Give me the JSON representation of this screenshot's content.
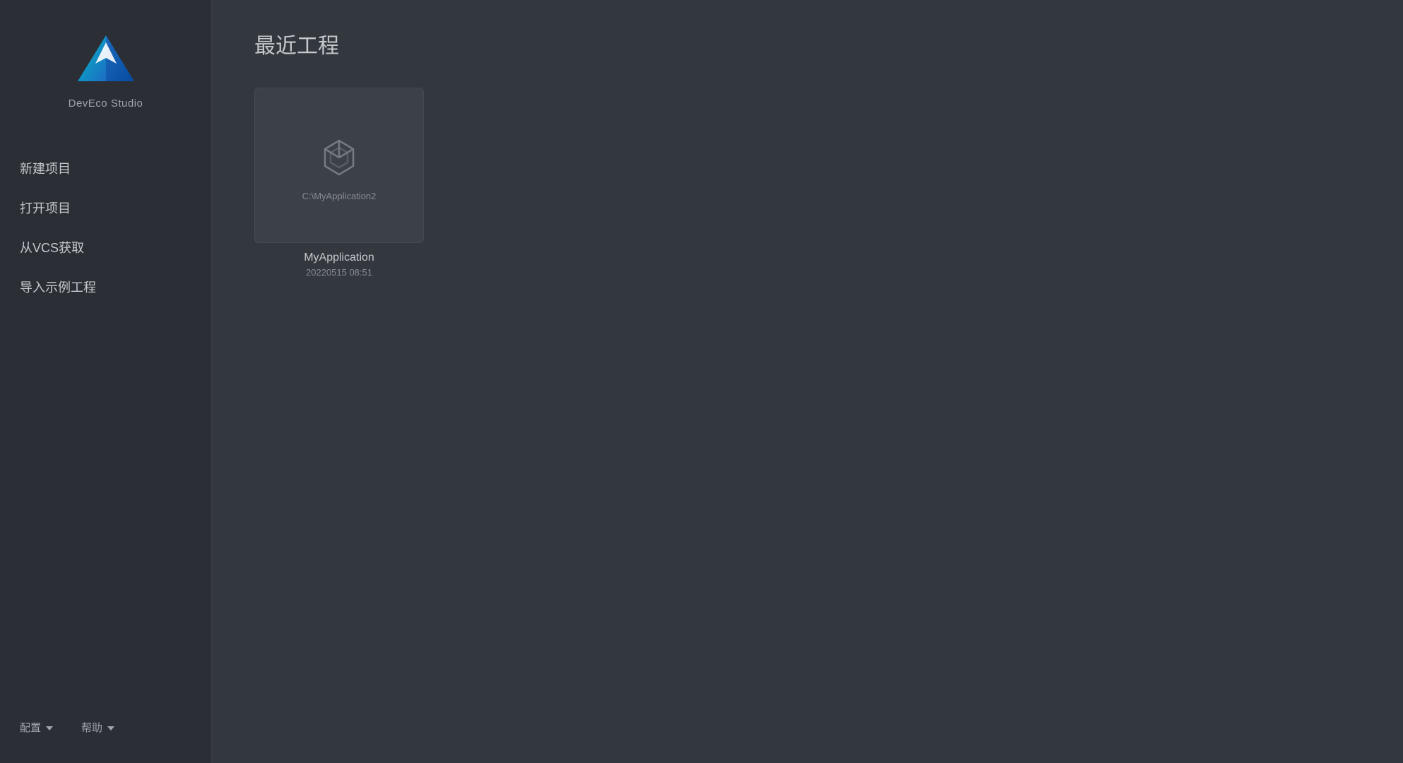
{
  "sidebar": {
    "logo_label": "DevEco Studio",
    "nav": {
      "new_project": "新建项目",
      "open_project": "打开项目",
      "get_vcs": "从VCS获取",
      "import_sample": "导入示例工程"
    },
    "footer": {
      "config_label": "配置",
      "help_label": "帮助"
    }
  },
  "main": {
    "title": "最近工程",
    "projects": [
      {
        "path": "C:\\MyApplication2",
        "name": "MyApplication",
        "date": "20220515 08:51"
      }
    ]
  }
}
